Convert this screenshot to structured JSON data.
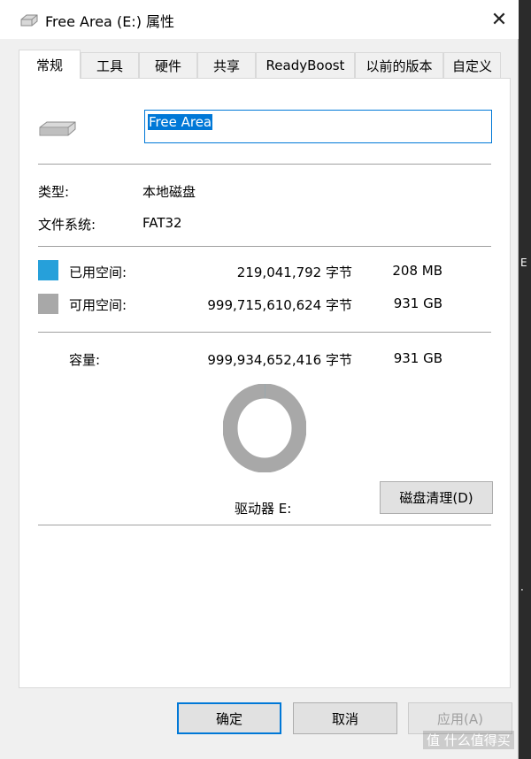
{
  "window": {
    "title": "Free Area (E:) 属性",
    "close_glyph": "✕"
  },
  "tabs": [
    {
      "label": "常规",
      "active": true
    },
    {
      "label": "工具"
    },
    {
      "label": "硬件"
    },
    {
      "label": "共享"
    },
    {
      "label": "ReadyBoost"
    },
    {
      "label": "以前的版本"
    },
    {
      "label": "自定义"
    }
  ],
  "general": {
    "volume_name": "Free Area",
    "type_label": "类型:",
    "type_value": "本地磁盘",
    "fs_label": "文件系统:",
    "fs_value": "FAT32",
    "used_label": "已用空间:",
    "used_bytes": "219,041,792 字节",
    "used_size": "208 MB",
    "free_label": "可用空间:",
    "free_bytes": "999,715,610,624 字节",
    "free_size": "931 GB",
    "capacity_label": "容量:",
    "capacity_bytes": "999,934,652,416 字节",
    "capacity_size": "931 GB",
    "drive_label": "驱动器 E:",
    "cleanup_button": "磁盘清理(D)",
    "used_fraction": 0.000219,
    "used_color": "#26a0da",
    "free_color": "#a8a8a8"
  },
  "footer": {
    "ok": "确定",
    "cancel": "取消",
    "apply": "应用(A)"
  },
  "watermark": "值 什么值得买",
  "icons": {
    "title": "drive-icon",
    "drive": "drive-icon",
    "close": "close-icon"
  }
}
